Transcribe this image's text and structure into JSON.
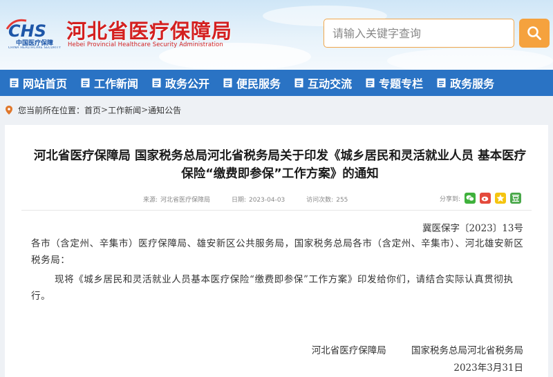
{
  "header": {
    "logo_text": "CHS",
    "logo_subtitle": "中国医疗保障",
    "logo_subtitle_en": "CHINA HEALTHCARE SECURITY",
    "site_title": "河北省医疗保障局",
    "site_title_en": "Hebei Provincial Healthcare Security Administration",
    "search_placeholder": "请输入关键字查询"
  },
  "nav": {
    "items": [
      {
        "label": "网站首页"
      },
      {
        "label": "工作新闻"
      },
      {
        "label": "政务公开"
      },
      {
        "label": "便民服务"
      },
      {
        "label": "互动交流"
      },
      {
        "label": "专题专栏"
      },
      {
        "label": "政务服务"
      }
    ]
  },
  "breadcrumb": {
    "prefix": "您当前所在位置：",
    "items": [
      "首页",
      "工作新闻",
      "通知公告"
    ],
    "separator": ">"
  },
  "article": {
    "title": "河北省医疗保障局 国家税务总局河北省税务局关于印发《城乡居民和灵活就业人员 基本医疗保险“缴费即参保”工作方案》的通知",
    "meta": {
      "source_label": "来源:",
      "source": "河北省医疗保障局",
      "date_label": "日期:",
      "date": "2023-04-03",
      "views_label": "访问次数:",
      "views": "255"
    },
    "share_label": "分享到:",
    "doc_number": "冀医保字〔2023〕13号",
    "addressee": "各市（含定州、辛集市）医疗保障局、雄安新区公共服务局，国家税务总局各市（含定州、辛集市）、河北雄安新区税务局：",
    "paragraph": "现将《城乡居民和灵活就业人员基本医疗保险“缴费即参保”工作方案》印发给你们，请结合实际认真贯彻执行。",
    "signer_1": "河北省医疗保障局",
    "signer_2": "国家税务总局河北省税务局",
    "sign_date": "2023年3月31日"
  },
  "colors": {
    "nav_bg": "#2a73c4",
    "title_red": "#d32020",
    "search_orange": "#f5a23e",
    "logo_blue": "#1d56a8"
  },
  "icons": {
    "search": "magnifier-icon",
    "nav": "document-icon",
    "location": "map-pin-icon",
    "share": [
      "wechat-icon",
      "weibo-icon",
      "qzone-icon",
      "douban-icon"
    ]
  }
}
